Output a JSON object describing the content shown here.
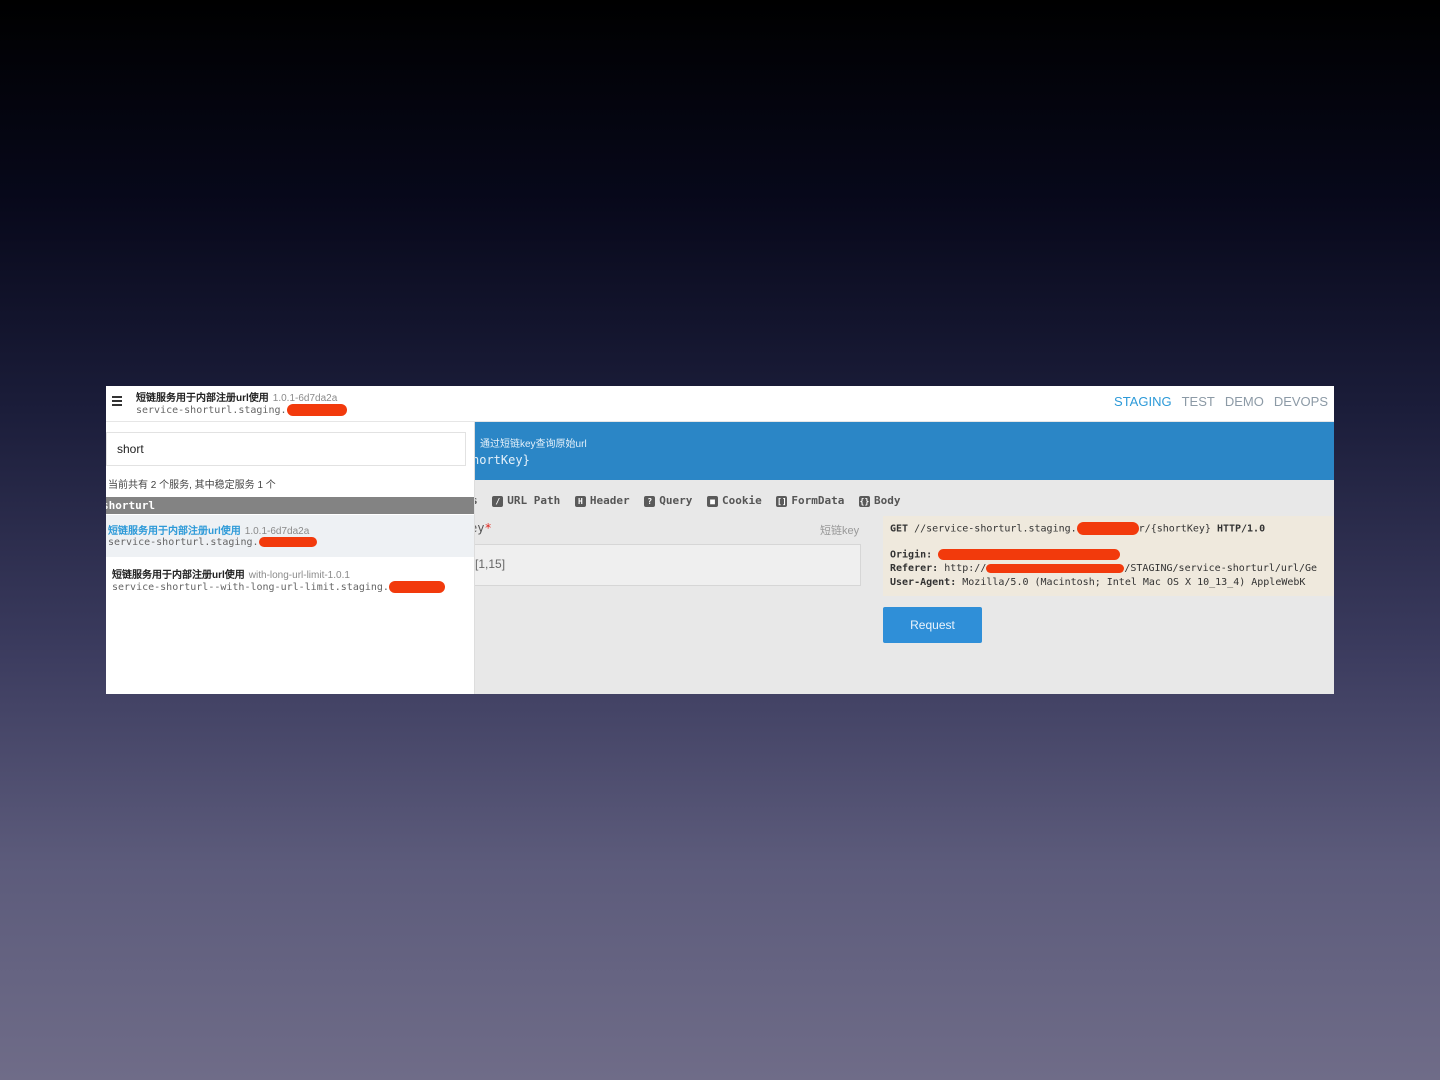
{
  "header": {
    "title": "短链服务用于内部注册url使用",
    "version": "1.0.1-6d7da2a",
    "host": "service-shorturl.staging.",
    "env_tabs": [
      "STAGING",
      "TEST",
      "DEMO",
      "DEVOPS"
    ],
    "active_env": "STAGING"
  },
  "sidebar": {
    "search_value": "short",
    "summary": "当前共有 2 个服务, 其中稳定服务 1 个",
    "group": "shorturl",
    "items": [
      {
        "name": "短链服务用于内部注册url使用",
        "version": "1.0.1-6d7da2a",
        "host": "service-shorturl.staging.",
        "selected": true
      },
      {
        "name": "短链服务用于内部注册url使用",
        "version": "with-long-url-limit-1.0.1",
        "host": "service-shorturl--with-long-url-limit.staging.",
        "selected": false
      }
    ]
  },
  "main": {
    "description": "通过短链key查询原始url",
    "path_fragment": "hortKey}",
    "tabs": [
      {
        "icon": "s",
        "label": ""
      },
      {
        "icon": "/",
        "label": "URL Path"
      },
      {
        "icon": "H",
        "label": "Header"
      },
      {
        "icon": "?",
        "label": "Query"
      },
      {
        "icon": "■",
        "label": "Cookie"
      },
      {
        "icon": "[]",
        "label": "FormData"
      },
      {
        "icon": "{}",
        "label": "Body"
      }
    ],
    "param_label": "ey",
    "param_required_mark": "*",
    "param_hint": "短链key",
    "param_value": "[1,15]",
    "request": {
      "method": "GET",
      "url_start": "//service-shorturl.staging.",
      "url_end": "r/{shortKey}",
      "protocol": "HTTP/1.0",
      "origin_label": "Origin:",
      "referer_label": "Referer:",
      "referer_start": "http://",
      "referer_end": "/STAGING/service-shorturl/url/Ge",
      "ua_label": "User-Agent:",
      "ua_value": "Mozilla/5.0 (Macintosh; Intel Mac OS X 10_13_4) AppleWebK"
    },
    "request_button": "Request"
  },
  "colors": {
    "accent": "#2d9ad8",
    "banner": "#2b86c6",
    "redaction": "#f23a0c"
  }
}
